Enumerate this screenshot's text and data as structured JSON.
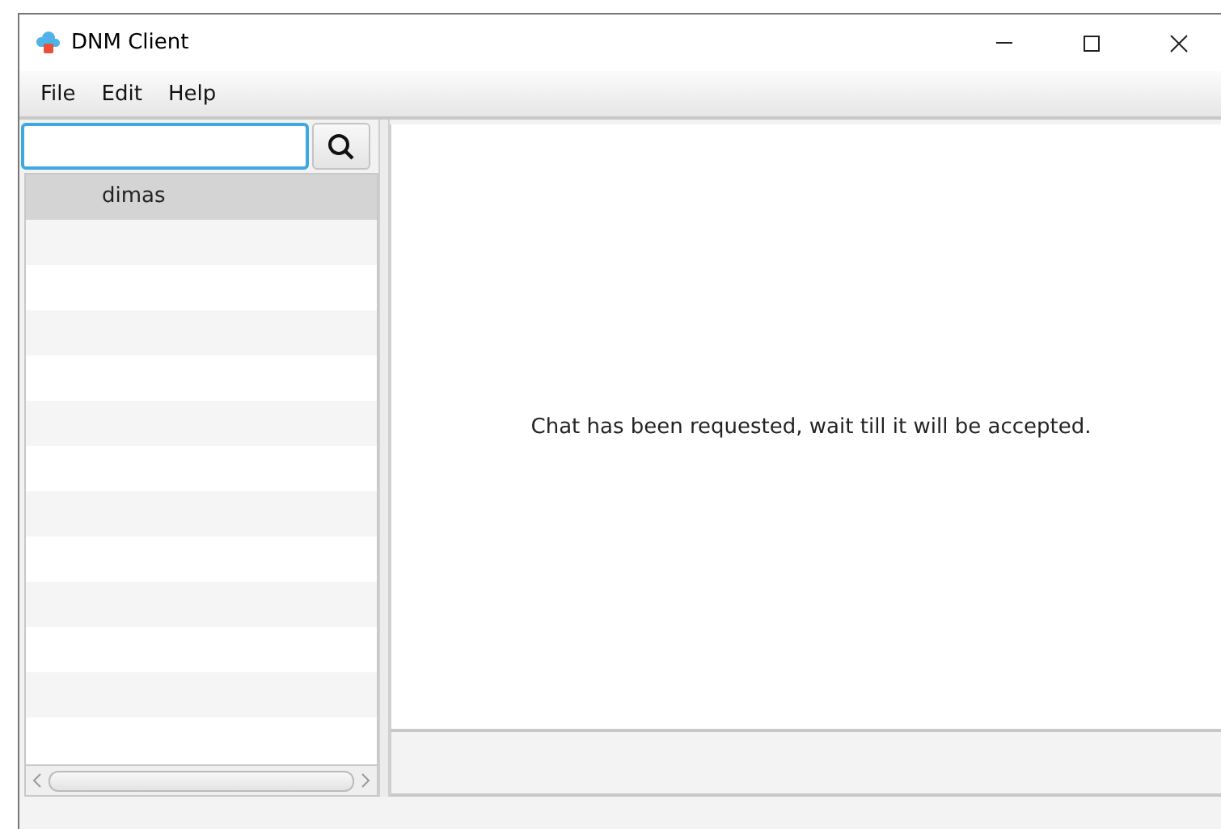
{
  "window": {
    "title": "DNM Client"
  },
  "menu": [
    "File",
    "Edit",
    "Help"
  ],
  "contacts": [
    {
      "name": "dimas",
      "selected": true
    }
  ],
  "chat": {
    "message": "Chat has been requested, wait till it will be accepted."
  }
}
